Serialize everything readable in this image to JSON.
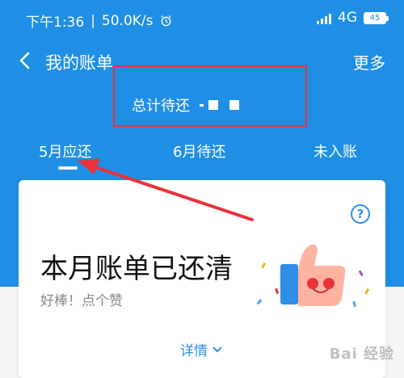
{
  "status_bar": {
    "time": "下午1:36",
    "speed": "50.0K/s",
    "network": "4G",
    "battery": "45"
  },
  "nav": {
    "title": "我的账单",
    "more_label": "更多"
  },
  "summary": {
    "total_label": "总计待还"
  },
  "tabs": [
    {
      "label": "5月应还",
      "active": true
    },
    {
      "label": "6月待还",
      "active": false
    },
    {
      "label": "未入账",
      "active": false
    }
  ],
  "card": {
    "title": "本月账单已还清",
    "subtitle": "好棒！点个赞",
    "detail_label": "详情",
    "help_symbol": "?"
  },
  "watermark": "Bai 经验",
  "colors": {
    "primary_blue": "#1f8fe5",
    "annotation_red": "#e8333b"
  }
}
